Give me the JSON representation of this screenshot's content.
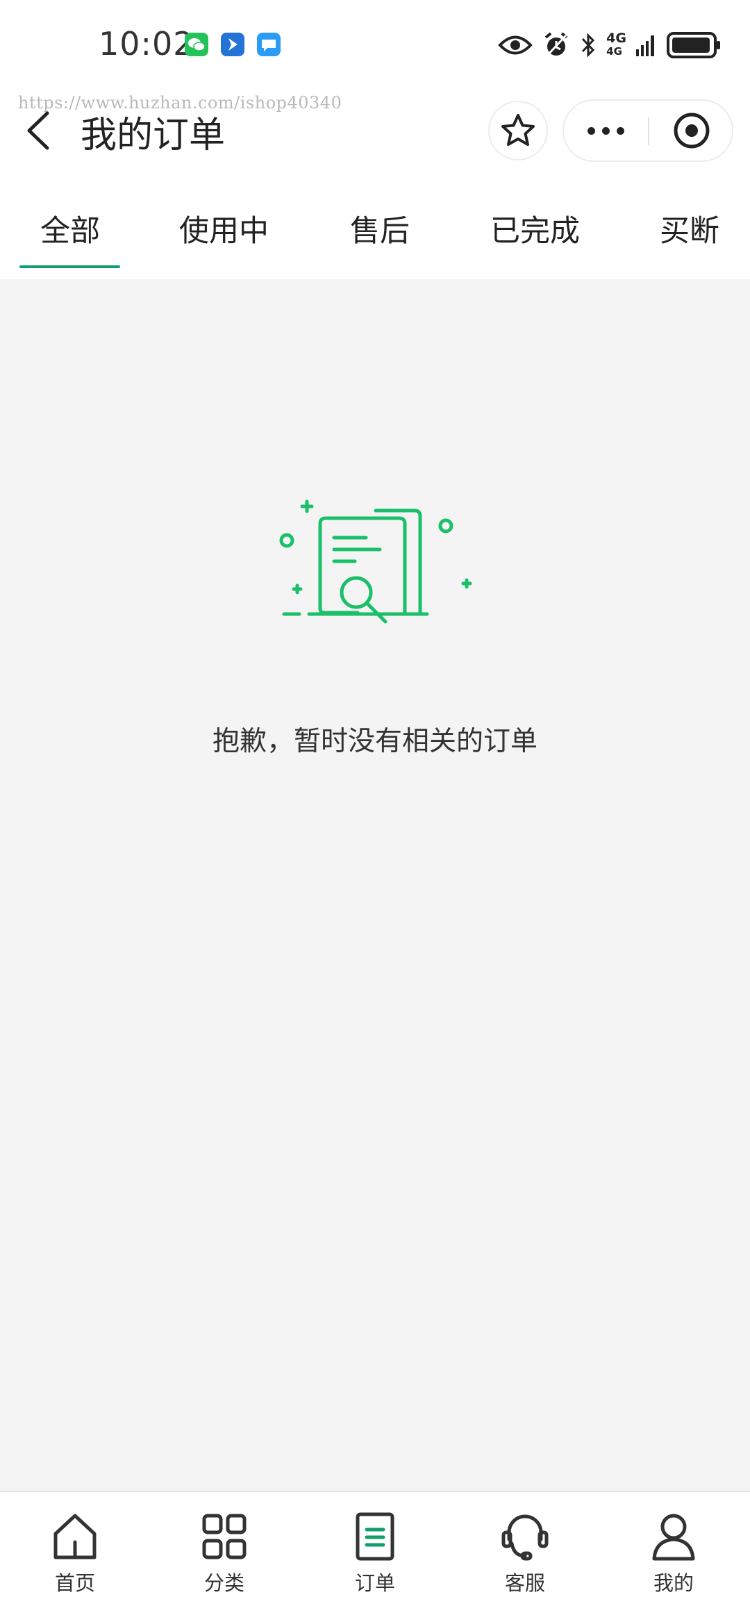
{
  "status_bar": {
    "time": "10:02",
    "network": [
      "4G",
      "4G"
    ],
    "apps": [
      "wechat-app",
      "messenger-app",
      "chat-app"
    ]
  },
  "watermark": "https://www.huzhan.com/ishop40340",
  "header": {
    "title": "我的订单"
  },
  "tabs": [
    {
      "label": "全部",
      "active": true
    },
    {
      "label": "使用中",
      "active": false
    },
    {
      "label": "售后",
      "active": false
    },
    {
      "label": "已完成",
      "active": false
    },
    {
      "label": "买断",
      "active": false
    }
  ],
  "empty_state": {
    "message": "抱歉，暂时没有相关的订单",
    "icon": "empty-orders-illustration"
  },
  "bottom_nav": [
    {
      "label": "首页",
      "icon": "home-icon"
    },
    {
      "label": "分类",
      "icon": "category-grid-icon"
    },
    {
      "label": "订单",
      "icon": "order-icon"
    },
    {
      "label": "客服",
      "icon": "headset-icon"
    },
    {
      "label": "我的",
      "icon": "user-icon"
    }
  ],
  "colors": {
    "accent": "#12a06a",
    "illustration": "#1bbf6a",
    "background": "#f4f4f4",
    "wechat": "#24c35a",
    "blue_app": "#2473d6",
    "chat_app": "#2a9cf5"
  }
}
